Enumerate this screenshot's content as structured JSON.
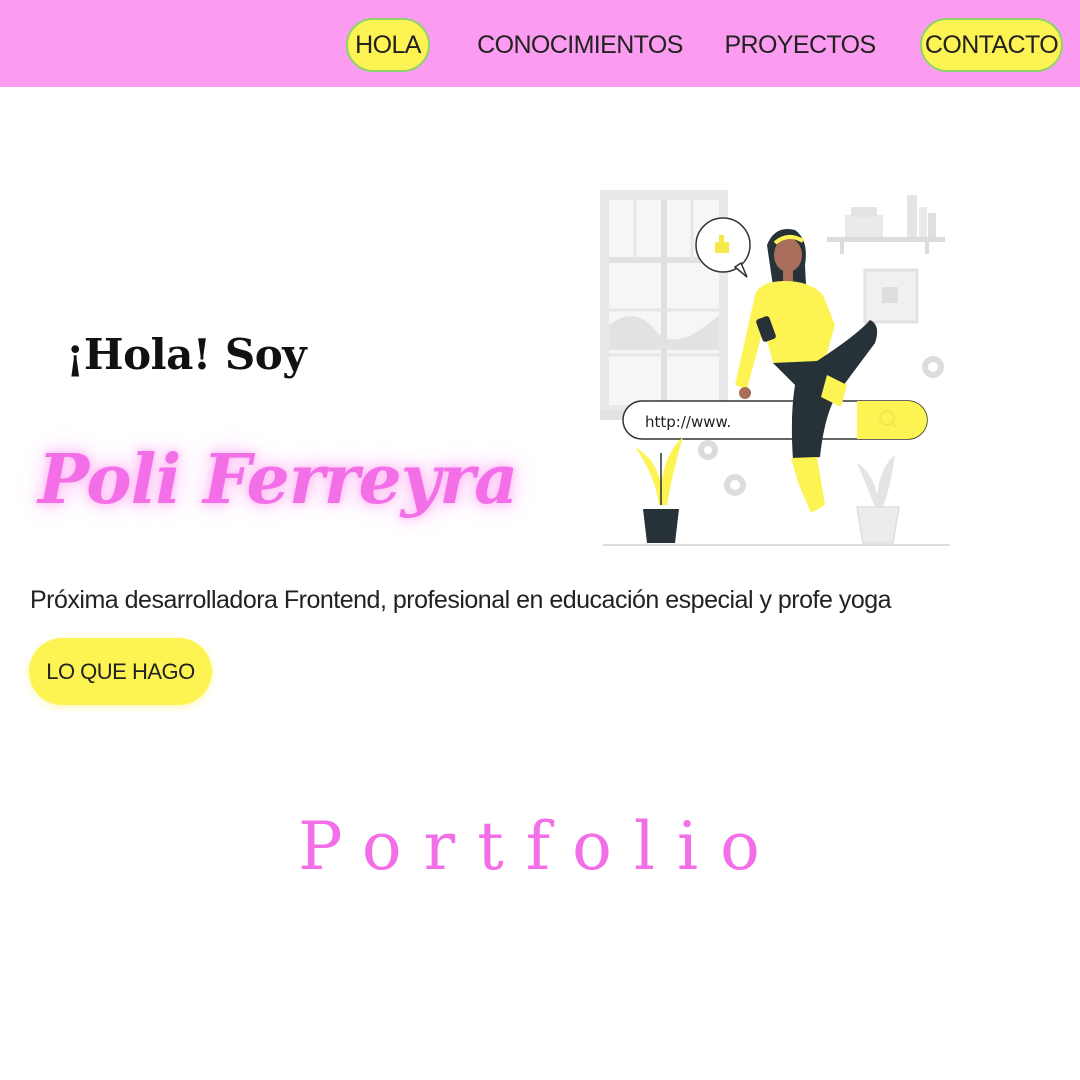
{
  "nav": {
    "items": [
      {
        "label": "HOLA",
        "highlighted": true
      },
      {
        "label": "CONOCIMIENTOS",
        "highlighted": false
      },
      {
        "label": "PROYECTOS",
        "highlighted": false
      },
      {
        "label": "CONTACTO",
        "highlighted": true
      }
    ]
  },
  "hero": {
    "greeting": "¡Hola! Soy",
    "name": "Poli Ferreyra",
    "tagline": "Próxima desarrolladora Frontend, profesional en educación especial y profe yoga",
    "cta_label": "LO QUE HAGO",
    "illustration": {
      "url_bar_text": "http://www."
    }
  },
  "section_title": "Portfolio",
  "colors": {
    "navbar_bg": "#fb9cf0",
    "accent_yellow": "#fdf352",
    "accent_pink": "#f26fe7"
  }
}
